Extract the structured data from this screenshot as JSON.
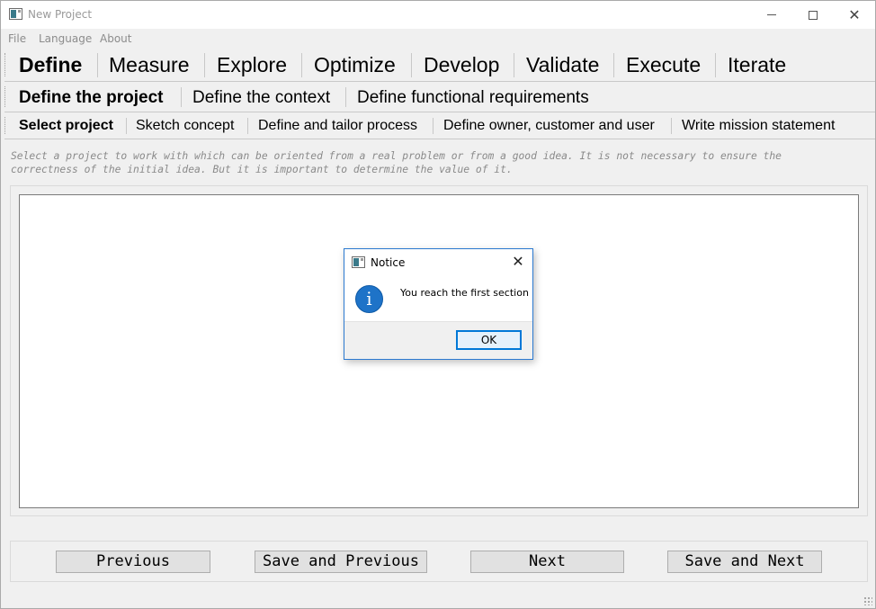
{
  "window": {
    "title": "New Project",
    "controls": {
      "minimize": "minimize-icon",
      "maximize": "maximize-icon",
      "close": "close-icon"
    }
  },
  "menu": [
    "File",
    "Language",
    "About"
  ],
  "phase_tabs": {
    "items": [
      "Define",
      "Measure",
      "Explore",
      "Optimize",
      "Develop",
      "Validate",
      "Execute",
      "Iterate"
    ],
    "active": "Define"
  },
  "step_tabs": {
    "items": [
      "Define the project",
      "Define the context",
      "Define functional requirements"
    ],
    "active": "Define the project"
  },
  "task_tabs": {
    "items": [
      "Select project",
      "Sketch concept",
      "Define and tailor process",
      "Define owner, customer and user",
      "Write mission statement"
    ],
    "active": "Select project"
  },
  "description": {
    "line1": "Select a project to work with which can be oriented from a real problem or from a good idea. It is not necessary to ensure the",
    "line2": "correctness of the initial idea. But it is important to determine the value of it."
  },
  "editor": {
    "value": ""
  },
  "buttons": {
    "previous": "Previous",
    "save_previous": "Save and Previous",
    "next": "Next",
    "save_next": "Save and Next"
  },
  "dialog": {
    "title": "Notice",
    "message": "You reach the first section",
    "ok": "OK",
    "icon": "info-icon",
    "info_glyph": "i"
  }
}
